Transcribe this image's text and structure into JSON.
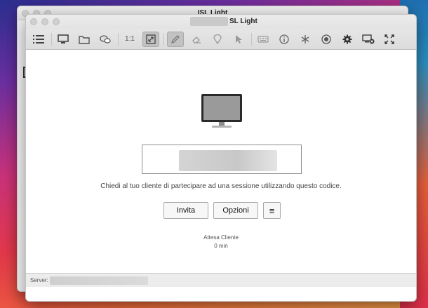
{
  "back_window": {
    "title": "ISL Light"
  },
  "window": {
    "title": "SL Light"
  },
  "toolbar": {
    "zoom_label": "1:1",
    "icons": [
      "list-icon",
      "monitor-icon",
      "folder-icon",
      "chat-icon",
      "zoom-1-1",
      "fit-screen-icon",
      "pencil-icon",
      "eraser-icon",
      "pin-icon",
      "pointer-icon",
      "keyboard-icon",
      "info-icon",
      "asterisk-icon",
      "record-icon",
      "gear-icon",
      "disconnect-screen-icon",
      "fullscreen-icon"
    ]
  },
  "main": {
    "instructions": "Chiedi al tuo cliente di partecipare ad una sessione utilizzando questo codice.",
    "invite_label": "Invita",
    "options_label": "Opzioni",
    "menu_label": "≡",
    "status_title": "Attesa Cliente",
    "status_time": "0 min"
  },
  "statusbar": {
    "server_label": "Server:"
  }
}
